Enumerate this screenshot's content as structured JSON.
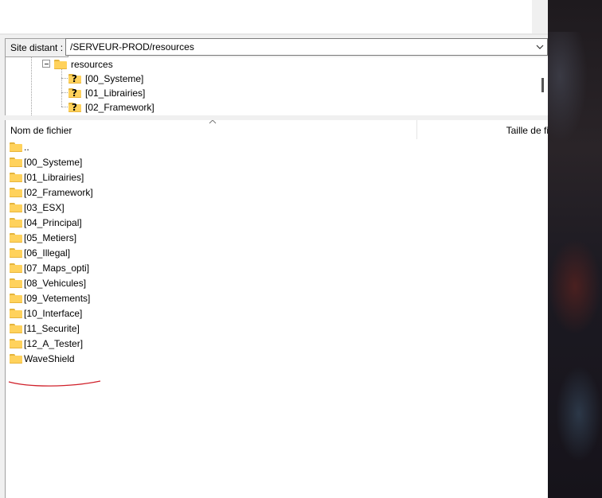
{
  "remote_site": {
    "label": "Site distant :",
    "path": "/SERVEUR-PROD/resources"
  },
  "tree": {
    "parent": {
      "label": "resources",
      "icon": "folder-open-icon"
    },
    "children": [
      {
        "label": "[00_Systeme]",
        "icon": "folder-unknown-icon"
      },
      {
        "label": "[01_Librairies]",
        "icon": "folder-unknown-icon"
      },
      {
        "label": "[02_Framework]",
        "icon": "folder-unknown-icon"
      }
    ]
  },
  "file_list": {
    "columns": {
      "name": "Nom de fichier",
      "size": "Taille de fi"
    },
    "rows": [
      {
        "name": ".."
      },
      {
        "name": "[00_Systeme]"
      },
      {
        "name": "[01_Librairies]"
      },
      {
        "name": "[02_Framework]"
      },
      {
        "name": "[03_ESX]"
      },
      {
        "name": "[04_Principal]"
      },
      {
        "name": "[05_Metiers]"
      },
      {
        "name": "[06_Illegal]"
      },
      {
        "name": "[07_Maps_opti]"
      },
      {
        "name": "[08_Vehicules]"
      },
      {
        "name": "[09_Vetements]"
      },
      {
        "name": "[10_Interface]"
      },
      {
        "name": "[11_Securite]"
      },
      {
        "name": "[12_A_Tester]"
      },
      {
        "name": "WaveShield"
      }
    ]
  },
  "colors": {
    "folder": "#ffd25c",
    "annotation_underline": "#d0202a"
  }
}
